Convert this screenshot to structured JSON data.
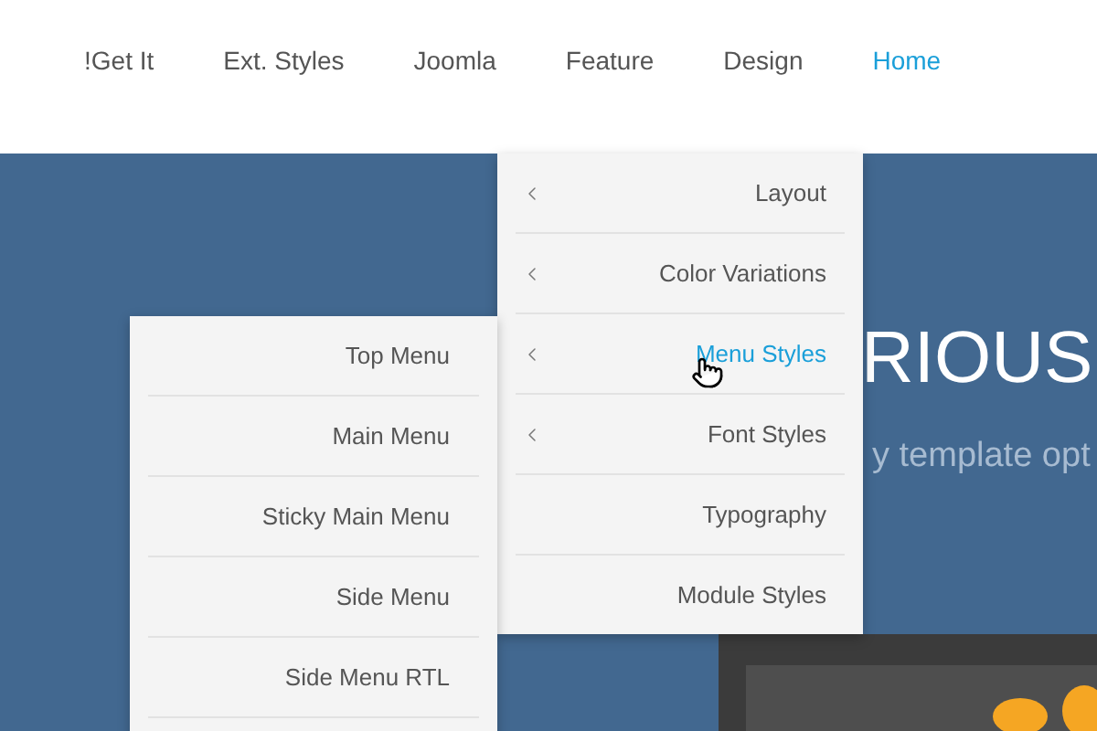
{
  "nav": {
    "items": [
      {
        "label": "!Get It",
        "selected": false
      },
      {
        "label": "Ext. Styles",
        "selected": false
      },
      {
        "label": "Joomla",
        "selected": false
      },
      {
        "label": "Feature",
        "selected": false
      },
      {
        "label": "Design",
        "selected": false
      },
      {
        "label": "Home",
        "selected": true
      }
    ]
  },
  "hero": {
    "heading": "RIOUS",
    "subtitle": "y template opt"
  },
  "dropdown": {
    "items": [
      {
        "label": "Layout",
        "has_submenu": true,
        "selected": false
      },
      {
        "label": "Color Variations",
        "has_submenu": true,
        "selected": false
      },
      {
        "label": "Menu Styles",
        "has_submenu": true,
        "selected": true
      },
      {
        "label": "Font Styles",
        "has_submenu": true,
        "selected": false
      },
      {
        "label": "Typography",
        "has_submenu": false,
        "selected": false
      },
      {
        "label": "Module Styles",
        "has_submenu": false,
        "selected": false
      }
    ]
  },
  "submenu": {
    "items": [
      {
        "label": "Top Menu"
      },
      {
        "label": "Main Menu"
      },
      {
        "label": "Sticky Main Menu"
      },
      {
        "label": "Side Menu"
      },
      {
        "label": "Side Menu RTL"
      }
    ]
  }
}
